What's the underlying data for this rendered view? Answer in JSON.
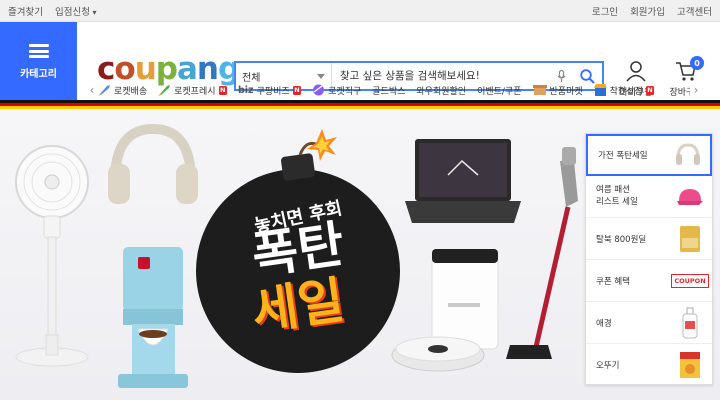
{
  "topbar": {
    "left": [
      "즐겨찾기",
      "입점신청"
    ],
    "right": [
      "로그인",
      "회원가입",
      "고객센터"
    ]
  },
  "category_button": {
    "label": "카테고리"
  },
  "logo": {
    "text": "coupang"
  },
  "search": {
    "category": "전체",
    "placeholder": "찾고 싶은 상품을 검색해보세요!"
  },
  "header_icons": {
    "mypage": "마이쿠팡",
    "cart": "장바구니",
    "cart_count": "0"
  },
  "nav": {
    "items": [
      {
        "label": "로켓배송",
        "icon": "rocket-icon",
        "badge": ""
      },
      {
        "label": "로켓프레시",
        "icon": "rocket-fresh-icon",
        "badge": "N"
      },
      {
        "label": "쿠팡비즈",
        "icon": "biz-icon",
        "prefix": "biz",
        "badge": "N"
      },
      {
        "label": "로켓직구",
        "icon": "globe-icon",
        "badge": ""
      },
      {
        "label": "골드박스",
        "icon": "",
        "badge": ""
      },
      {
        "label": "와우회원할인",
        "icon": "",
        "badge": ""
      },
      {
        "label": "이벤트/쿠폰",
        "icon": "",
        "badge": ""
      },
      {
        "label": "반품마켓",
        "icon": "box-icon",
        "badge": ""
      },
      {
        "label": "착한상점",
        "icon": "shop-icon",
        "badge": "N"
      }
    ]
  },
  "banner": {
    "headline_small": "놓치면 후회",
    "headline_line1": "폭탄",
    "headline_line2": "세일"
  },
  "side_list": {
    "items": [
      {
        "label": "가전 폭탄세일",
        "thumb": "headphones-icon"
      },
      {
        "label": "여름 패션\n리스트 세일",
        "thumb": "cap-icon"
      },
      {
        "label": "탈북 800원딜",
        "thumb": "snack-icon"
      },
      {
        "label": "쿠폰 혜택",
        "thumb": "coupon-icon"
      },
      {
        "label": "애경",
        "thumb": "bottle-icon"
      },
      {
        "label": "오뚜기",
        "thumb": "food-box-icon"
      }
    ],
    "coupon_text": "COUPON"
  },
  "colors": {
    "accent": "#346aff",
    "flag": [
      "#111111",
      "#dd0000",
      "#ffcc00"
    ]
  }
}
